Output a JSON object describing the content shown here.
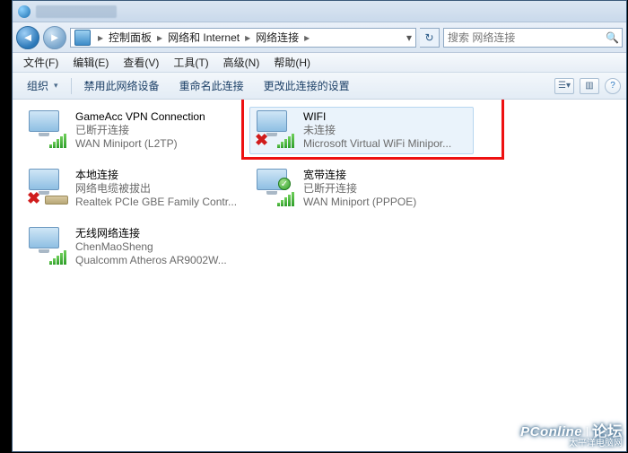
{
  "breadcrumb": {
    "items": [
      "控制面板",
      "网络和 Internet",
      "网络连接"
    ]
  },
  "search": {
    "placeholder": "搜索 网络连接"
  },
  "menu": {
    "file": "文件(F)",
    "edit": "编辑(E)",
    "view": "查看(V)",
    "tools": "工具(T)",
    "advanced": "高级(N)",
    "help": "帮助(H)"
  },
  "cmd": {
    "organize": "组织",
    "disable": "禁用此网络设备",
    "rename": "重命名此连接",
    "settings": "更改此连接的设置"
  },
  "connections": [
    {
      "name": "GameAcc VPN Connection",
      "status": "已断开连接",
      "device": "WAN Miniport (L2TP)",
      "icon": "monitor-bars",
      "overlay": "none",
      "selected": false
    },
    {
      "name": "WIFI",
      "status": "未连接",
      "device": "Microsoft Virtual WiFi Minipor...",
      "icon": "monitor-bars",
      "overlay": "redx",
      "selected": true
    },
    {
      "name": "本地连接",
      "status": "网络电缆被拔出",
      "device": "Realtek PCIe GBE Family Contr...",
      "icon": "monitor-cable",
      "overlay": "redx",
      "selected": false
    },
    {
      "name": "宽带连接",
      "status": "已断开连接",
      "device": "WAN Miniport (PPPOE)",
      "icon": "monitor-bars",
      "overlay": "greencheck",
      "selected": false
    },
    {
      "name": "无线网络连接",
      "status": "ChenMaoSheng",
      "device": "Qualcomm Atheros AR9002W...",
      "icon": "monitor-bars",
      "overlay": "none",
      "selected": false
    }
  ],
  "watermark": {
    "brand": "PConline",
    "sub": "太平洋电脑网",
    "forum": "论坛"
  }
}
